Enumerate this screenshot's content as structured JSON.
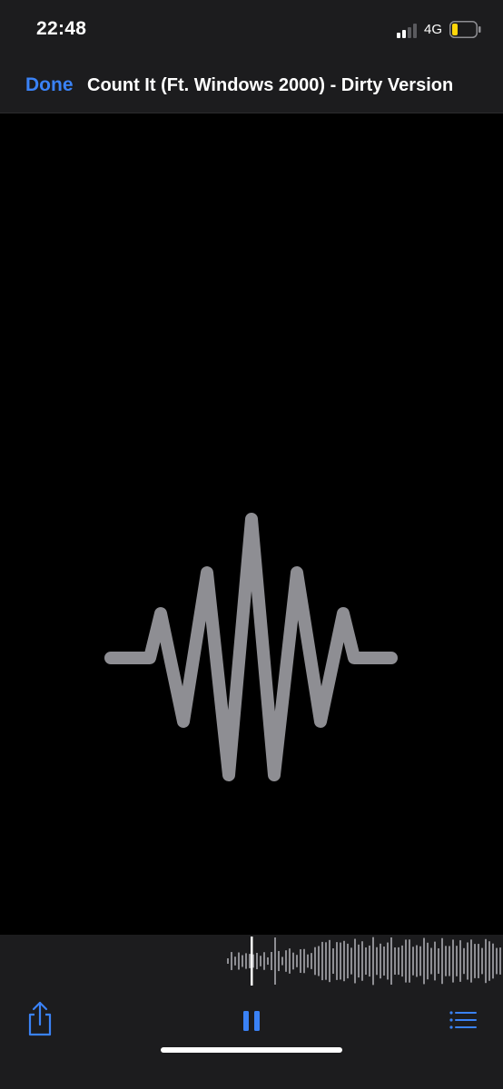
{
  "status_bar": {
    "time": "22:48",
    "network": "4G",
    "signal_bars_active": 2,
    "signal_bars_total": 4,
    "battery_level": 0.2,
    "battery_color": "#ffd60a"
  },
  "nav": {
    "done_label": "Done",
    "title": "Count It (Ft. Windows 2000) - Dirty Version"
  },
  "preview": {
    "icon": "audio-waveform-icon",
    "icon_color": "#8e8e93"
  },
  "playback": {
    "state": "playing",
    "playhead_position": 0.07,
    "waveform_color": "#8e8e93",
    "accent_color": "#3a82f6"
  },
  "toolbar": {
    "share_icon": "share-icon",
    "pause_icon": "pause-icon",
    "list_icon": "list-icon"
  }
}
